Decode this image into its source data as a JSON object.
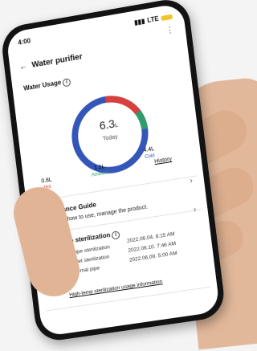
{
  "status_bar": {
    "time": "4:00",
    "network": "LTE"
  },
  "header": {
    "title": "Water purifier"
  },
  "usage": {
    "title": "Water Usage",
    "total": "6.3",
    "unit": "L",
    "period": "Today",
    "history_link": "History",
    "breakdown": [
      {
        "value": "0.8L",
        "label": "Hot",
        "color": "#d8403b"
      },
      {
        "value": "1.1L",
        "label": "Ambient",
        "color": "#2f9a6a"
      },
      {
        "value": "4.4L",
        "label": "Cold",
        "color": "#3456b8"
      }
    ]
  },
  "maintenance": {
    "title": "Maintenance Guide",
    "subtitle": "This is tips how to use, manage the product."
  },
  "sterilization": {
    "title": "High-temp sterilization",
    "rows": [
      {
        "label": "Last internal pipe sterilization",
        "value": "2022.06.04. 8:15 AM"
      },
      {
        "label": "Last water outlet sterilization",
        "value": "2022.06.10. 7:46 AM"
      },
      {
        "label": "Scheduled internal pipe sterilization",
        "value": "2022.06.09. 5:00 AM"
      }
    ],
    "info_link": "High-temp sterilization usage information"
  }
}
